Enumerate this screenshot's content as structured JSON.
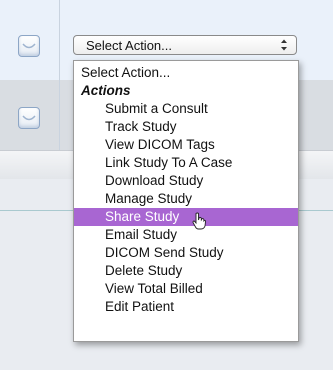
{
  "select": {
    "selected_value": "Select Action..."
  },
  "dropdown": {
    "placeholder_option": "Select Action...",
    "group_label": "Actions",
    "items": [
      "Submit a Consult",
      "Track Study",
      "View DICOM Tags",
      "Link Study To A Case",
      "Download Study",
      "Manage Study",
      "Share Study",
      "Email Study",
      "DICOM Send Study",
      "Delete Study",
      "View Total Billed",
      "Edit Patient"
    ],
    "highlighted_item": "Share Study"
  },
  "icons": {
    "row_checkbox": "checkbox-icon",
    "select_arrows": "up-down-arrows-icon",
    "pointer": "hand-pointer-icon"
  },
  "colors": {
    "highlight": "#a866d2",
    "row_background": "#eaf1fa"
  }
}
